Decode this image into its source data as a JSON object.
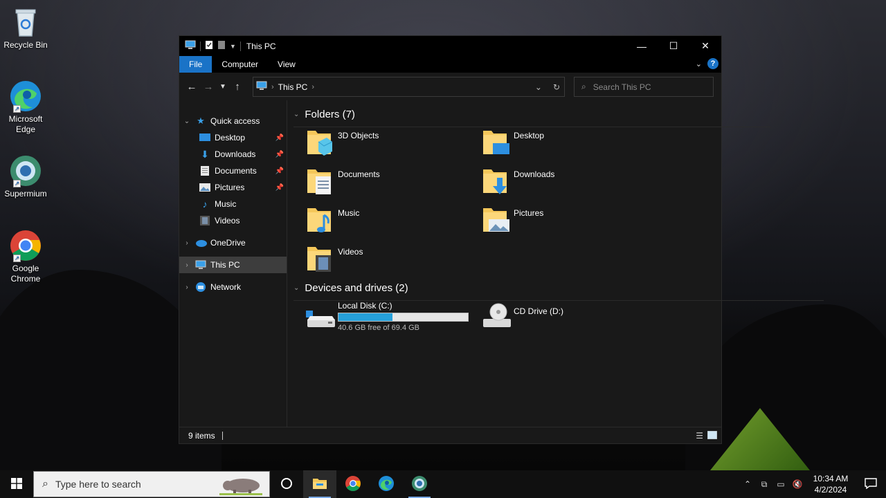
{
  "desktop": {
    "icons": [
      {
        "label": "Recycle Bin"
      },
      {
        "label": "Microsoft Edge"
      },
      {
        "label": "Supermium"
      },
      {
        "label": "Google Chrome"
      }
    ]
  },
  "window": {
    "title": "This PC",
    "ribbon_tabs": [
      "File",
      "Computer",
      "View"
    ],
    "help_glyph": "?",
    "address": {
      "crumb": "This PC"
    },
    "search": {
      "placeholder": "Search This PC"
    },
    "nav": {
      "quick_access": "Quick access",
      "quick_items": [
        "Desktop",
        "Downloads",
        "Documents",
        "Pictures",
        "Music",
        "Videos"
      ],
      "onedrive": "OneDrive",
      "this_pc": "This PC",
      "network": "Network"
    },
    "folders_header": "Folders (7)",
    "folders": [
      "3D Objects",
      "Desktop",
      "Documents",
      "Downloads",
      "Music",
      "Pictures",
      "Videos"
    ],
    "drives_header": "Devices and drives (2)",
    "drives": [
      {
        "name": "Local Disk (C:)",
        "free_text": "40.6 GB free of 69.4 GB",
        "used_fraction": 0.415
      },
      {
        "name": "CD Drive (D:)"
      }
    ],
    "status": {
      "items": "9 items"
    }
  },
  "taskbar": {
    "search_placeholder": "Type here to search",
    "clock": {
      "time": "10:34 AM",
      "date": "4/2/2024"
    }
  },
  "colors": {
    "accent": "#1a73c7",
    "drive_bar": "#26a0da",
    "folder": "#f5c75a"
  }
}
